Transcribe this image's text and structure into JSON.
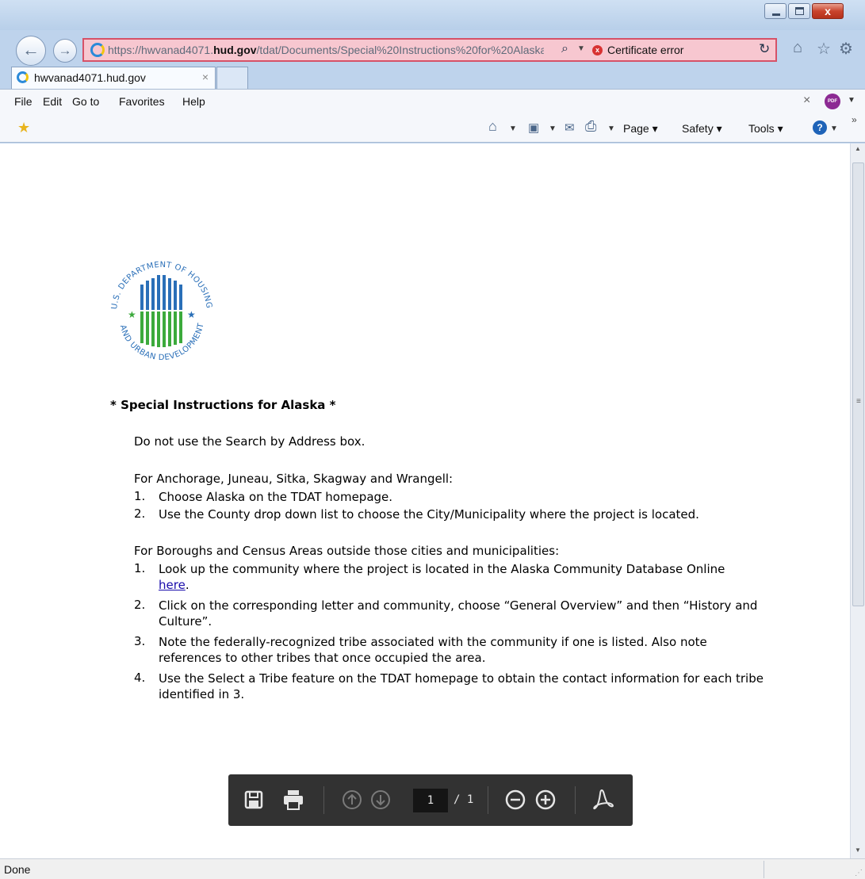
{
  "window": {
    "title_controls": {
      "minimize": "",
      "maximize": "",
      "close": "x"
    }
  },
  "address_bar": {
    "url_prefix": "https://hwvanad4071.",
    "url_domain": "hud.gov",
    "url_suffix": "/tdat/Documents/Special%20Instructions%20for%20Alaska.p",
    "certificate_error": "Certificate error"
  },
  "tabs": [
    {
      "title": "hwvanad4071.hud.gov",
      "close": "×"
    }
  ],
  "menu": {
    "items": [
      "File",
      "Edit",
      "Go to",
      "Favorites",
      "Help"
    ],
    "close": "×"
  },
  "command_bar": {
    "page": "Page",
    "safety": "Safety",
    "tools": "Tools"
  },
  "document": {
    "heading": "*  Special Instructions for Alaska *",
    "intro": "Do not use the Search by Address box.",
    "section1": {
      "lead": "For Anchorage, Juneau, Sitka, Skagway and Wrangell:",
      "steps": [
        {
          "num": "1.",
          "text": "Choose Alaska on the TDAT homepage."
        },
        {
          "num": "2.",
          "text": "Use the County drop down list to choose the City/Municipality where the project is located."
        }
      ]
    },
    "section2": {
      "lead": "For Boroughs and Census Areas outside those cities and municipalities:",
      "steps": [
        {
          "num": "1.",
          "text": "Look up the community where the project is located in the Alaska Community Database Online",
          "link": "here",
          "after_link": "."
        },
        {
          "num": "2.",
          "text": "Click on the corresponding letter and community, choose “General Overview” and then “History and Culture”."
        },
        {
          "num": "3.",
          "text": "Note the federally-recognized tribe associated with the community if one is listed.  Also note references to other tribes that once occupied the area."
        },
        {
          "num": "4.",
          "text": "Use the Select a Tribe feature on the TDAT homepage to obtain the contact information for each tribe identified in 3."
        }
      ]
    },
    "seal_text": "U.S. DEPARTMENT OF HOUSING AND URBAN DEVELOPMENT"
  },
  "pdf_toolbar": {
    "page_current": "1",
    "page_total": "/ 1"
  },
  "status_bar": {
    "text": "Done"
  },
  "colors": {
    "address_error_bg": "#f7c7d0",
    "address_error_border": "#d65268",
    "pdf_toolbar_bg": "#323232",
    "link": "#1a0dab",
    "seal_blue": "#2a6fb8",
    "seal_green": "#3caa3c"
  },
  "icons": [
    "back-arrow-icon",
    "forward-arrow-icon",
    "ie-logo-icon",
    "search-icon",
    "certificate-error-icon",
    "refresh-icon",
    "home-icon",
    "favorites-star-icon",
    "gear-icon",
    "add-favorite-icon",
    "feeds-icon",
    "mail-icon",
    "print-icon",
    "help-icon",
    "save-icon",
    "prev-page-icon",
    "next-page-icon",
    "zoom-out-icon",
    "zoom-in-icon",
    "acrobat-icon"
  ]
}
